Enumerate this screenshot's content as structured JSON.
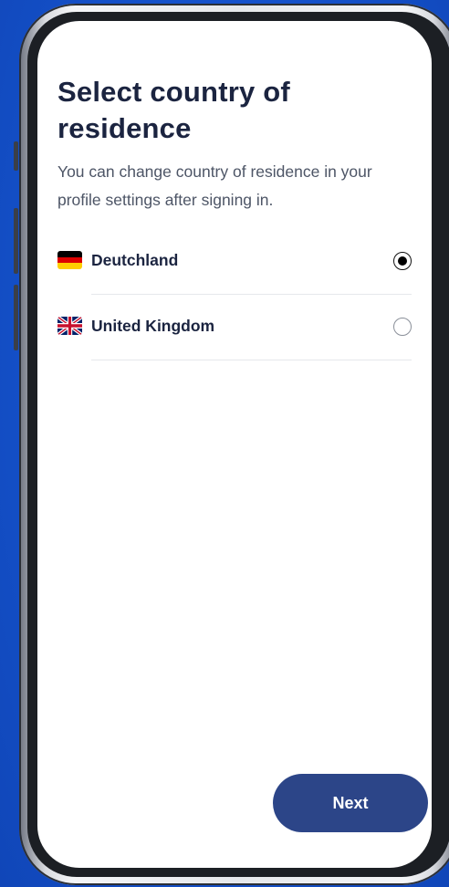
{
  "screen": {
    "title": "Select country of residence",
    "subtitle": "You can change country of residence in your profile settings after signing in."
  },
  "countries": [
    {
      "name": "Deutchland",
      "flag": "germany-flag",
      "selected": true
    },
    {
      "name": "United Kingdom",
      "flag": "uk-flag",
      "selected": false
    }
  ],
  "actions": {
    "next_label": "Next"
  },
  "colors": {
    "background": "#1450c8",
    "title_text": "#1b2440",
    "body_text": "#4d5566",
    "button": "#2c4588",
    "button_text": "#ffffff",
    "radio_selected": "#000000"
  }
}
